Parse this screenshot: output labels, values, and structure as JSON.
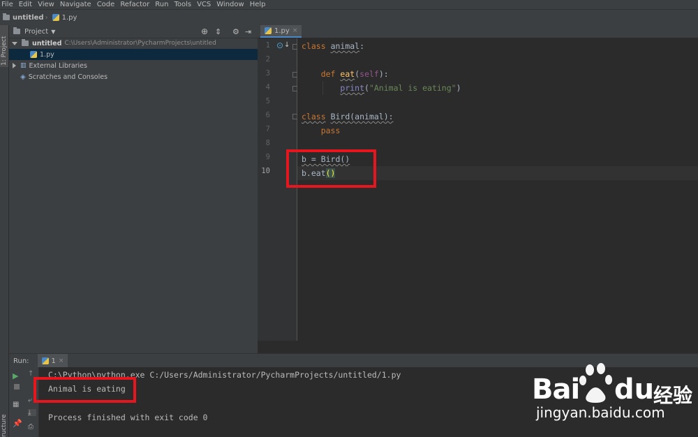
{
  "menu": [
    "File",
    "Edit",
    "View",
    "Navigate",
    "Code",
    "Refactor",
    "Run",
    "Tools",
    "VCS",
    "Window",
    "Help"
  ],
  "nav": {
    "project": "untitled",
    "file": "1.py"
  },
  "left_strip": {
    "project_tab": "1: Project",
    "structure_tab": "ructure"
  },
  "project_panel": {
    "title": "Project",
    "tree": [
      {
        "name": "untitled",
        "path": "C:\\Users\\Administrator\\PycharmProjects\\untitled"
      },
      {
        "name": "1.py"
      },
      {
        "name": "External Libraries"
      },
      {
        "name": "Scratches and Consoles"
      }
    ]
  },
  "editor": {
    "tab": "1.py",
    "line_numbers": [
      "1",
      "2",
      "3",
      "4",
      "5",
      "6",
      "7",
      "8",
      "9",
      "10"
    ],
    "code": {
      "l1_kw": "class",
      "l1_name": "animal",
      "l1_colon": ":",
      "l3_kw": "def",
      "l3_fn": "eat",
      "l3_open": "(",
      "l3_self": "self",
      "l3_close": "):",
      "l4_fn": "print",
      "l4_open": "(",
      "l4_str": "\"Animal is eating\"",
      "l4_close": ")",
      "l6_kw": "class",
      "l6_rest": "Bird(animal):",
      "l7_kw": "pass",
      "l9": "b = Bird()",
      "l10_a": "b.eat",
      "l10_b": "()"
    }
  },
  "run": {
    "label": "Run:",
    "config": "1",
    "console": [
      "C:\\Python\\python.exe C:/Users/Administrator/PycharmProjects/untitled/1.py",
      "Animal is eating",
      "",
      "Process finished with exit code 0"
    ]
  },
  "watermark": {
    "brand": "Bai",
    "brand2": "du",
    "cn": "经验",
    "url": "jingyan.baidu.com"
  },
  "colors": {
    "highlight_box": "#e6161e",
    "keyword": "#cc7832",
    "string": "#6a8759",
    "function": "#ffc66d"
  }
}
